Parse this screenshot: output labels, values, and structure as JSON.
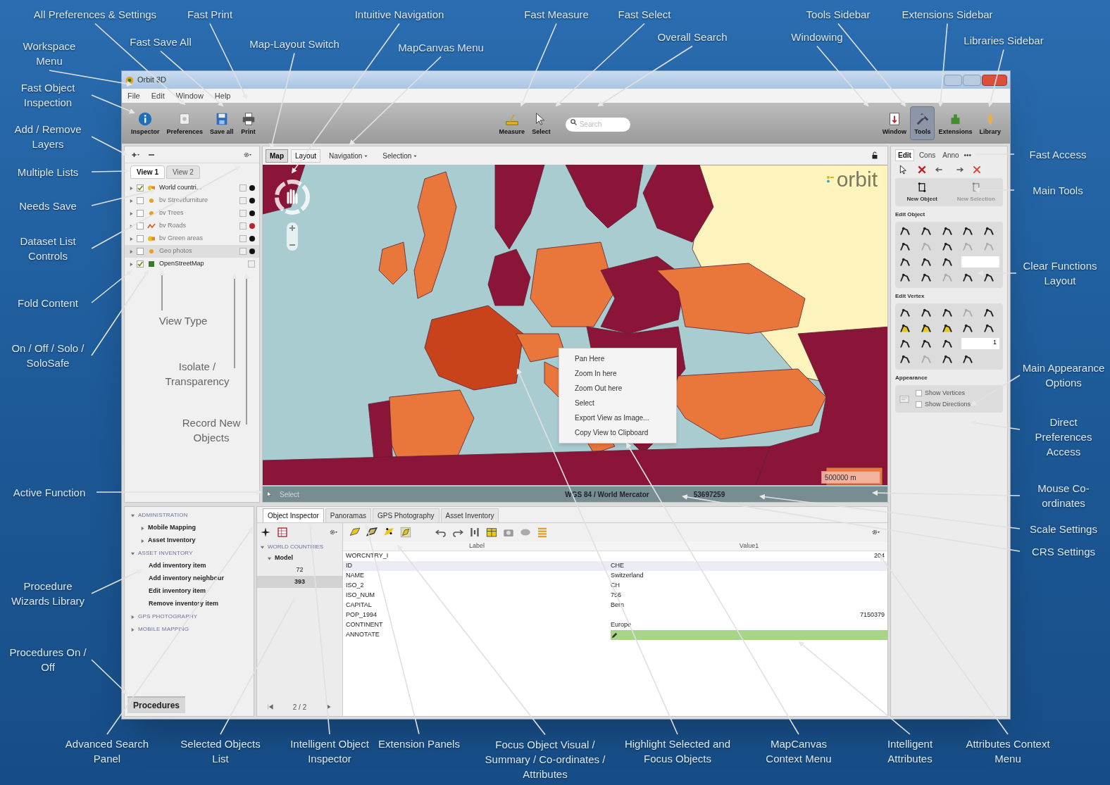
{
  "callouts": [
    {
      "text": "All Preferences & Settings"
    },
    {
      "text": "Fast Print"
    },
    {
      "text": "Fast Save All"
    },
    {
      "text": "Workspace Menu"
    },
    {
      "text": "Map-Layout Switch"
    },
    {
      "text": "Intuitive Navigation"
    },
    {
      "text": "MapCanvas Menu"
    },
    {
      "text": "Fast Measure"
    },
    {
      "text": "Fast Select"
    },
    {
      "text": "Overall Search"
    },
    {
      "text": "Tools Sidebar"
    },
    {
      "text": "Windowing"
    },
    {
      "text": "Extensions Sidebar"
    },
    {
      "text": "Libraries Sidebar"
    },
    {
      "text": "Fast Object Inspection"
    },
    {
      "text": "Add / Remove Layers"
    },
    {
      "text": "Multiple Lists"
    },
    {
      "text": "Needs Save"
    },
    {
      "text": "Dataset List Controls"
    },
    {
      "text": "Fold Content"
    },
    {
      "text": "On / Off / Solo / SoloSafe"
    },
    {
      "text": "View Type"
    },
    {
      "text": "Isolate / Transparency"
    },
    {
      "text": "Record New Objects"
    },
    {
      "text": "Active Function"
    },
    {
      "text": "Procedure Wizards Library"
    },
    {
      "text": "Procedures On / Off"
    },
    {
      "text": "Fast Access"
    },
    {
      "text": "Main Tools"
    },
    {
      "text": "Clear Functions Layout"
    },
    {
      "text": "Main Appearance Options"
    },
    {
      "text": "Direct Preferences Access"
    },
    {
      "text": "Mouse Co-ordinates"
    },
    {
      "text": "Scale Settings"
    },
    {
      "text": "CRS Settings"
    },
    {
      "text": "Advanced Search Panel"
    },
    {
      "text": "Selected Objects List"
    },
    {
      "text": "Intelligent Object Inspector"
    },
    {
      "text": "Extension Panels"
    },
    {
      "text": "Focus Object Visual / Summary / Co-ordinates / Attributes"
    },
    {
      "text": "Highlight Selected and Focus Objects"
    },
    {
      "text": "MapCanvas Context Menu"
    },
    {
      "text": "Intelligent Attributes"
    },
    {
      "text": "Attributes Context Menu"
    }
  ],
  "window": {
    "title": "Orbit 3D"
  },
  "menu": [
    "File",
    "Edit",
    "Window",
    "Help"
  ],
  "toolbar": {
    "left": [
      {
        "label": "Inspector",
        "kind": "info"
      },
      {
        "label": "Preferences",
        "kind": "prefs"
      },
      {
        "label": "Save all",
        "kind": "save"
      },
      {
        "label": "Print",
        "kind": "print"
      }
    ],
    "center": [
      {
        "label": "Measure",
        "kind": "measure"
      },
      {
        "label": "Select",
        "kind": "select"
      }
    ],
    "search": {
      "placeholder": "Search"
    },
    "right": [
      {
        "label": "Window",
        "kind": "window",
        "selected": false
      },
      {
        "label": "Tools",
        "kind": "tools",
        "selected": true
      },
      {
        "label": "Extensions",
        "kind": "extensions",
        "selected": false
      },
      {
        "label": "Library",
        "kind": "library",
        "selected": false
      }
    ]
  },
  "layers_panel": {
    "tabs": [
      {
        "label": "View 1",
        "selected": true
      },
      {
        "label": "View 2",
        "selected": false
      }
    ],
    "layers": [
      {
        "name": "World countri...",
        "visible": true,
        "isolated": false,
        "selected": false,
        "kind": "polygon",
        "color": "#111111"
      },
      {
        "name": "bv Streetfurniture",
        "visible": false,
        "isolated": false,
        "selected": false,
        "kind": "point",
        "color": "#111111"
      },
      {
        "name": "bv Trees",
        "visible": false,
        "isolated": false,
        "selected": false,
        "kind": "point",
        "color": "#111111"
      },
      {
        "name": "bv Roads",
        "visible": false,
        "isolated": false,
        "selected": false,
        "kind": "line",
        "color": "#c0202a"
      },
      {
        "name": "bv Green areas",
        "visible": false,
        "isolated": false,
        "selected": false,
        "kind": "polygon",
        "color": "#111111"
      },
      {
        "name": "Geo photos",
        "visible": false,
        "isolated": false,
        "selected": true,
        "kind": "point",
        "color": "#111111"
      },
      {
        "name": "OpenStreetMap",
        "visible": true,
        "isolated": false,
        "selected": false,
        "kind": "raster"
      }
    ]
  },
  "map": {
    "tabs": [
      {
        "label": "Map",
        "selected": true
      },
      {
        "label": "Layout",
        "selected": false
      }
    ],
    "menus": [
      "Navigation",
      "Selection"
    ],
    "logo": "orbit",
    "context_menu": [
      "Pan Here",
      "Zoom In here",
      "Zoom Out here",
      "Select",
      "Export View as Image...",
      "Copy View to Clipboard"
    ],
    "scale_field": "500000 m",
    "status": {
      "active_function": "Select",
      "crs": "WGS 84 / World Mercator",
      "scale": "53697259"
    }
  },
  "sidebar": {
    "tabs": [
      {
        "label": "Edit",
        "selected": true
      },
      {
        "label": "Cons",
        "selected": false
      },
      {
        "label": "Anno",
        "selected": false
      }
    ],
    "more": "•••",
    "main_tools": [
      {
        "label": "New Object",
        "disabled": false
      },
      {
        "label": "New Selection",
        "disabled": true
      }
    ],
    "sections": [
      {
        "title": "Edit Object",
        "tools": [
          {
            "kind": "tool",
            "disabled": false
          },
          {
            "kind": "tool",
            "disabled": false
          },
          {
            "kind": "tool",
            "disabled": false
          },
          {
            "kind": "tool",
            "disabled": false
          },
          {
            "kind": "tool",
            "disabled": false
          },
          {
            "kind": "tool",
            "disabled": false
          },
          {
            "kind": "tool",
            "disabled": true
          },
          {
            "kind": "tool",
            "disabled": false
          },
          {
            "kind": "tool",
            "disabled": true
          },
          {
            "kind": "tool",
            "disabled": true
          },
          {
            "kind": "tool",
            "disabled": false
          },
          {
            "kind": "tool",
            "disabled": false
          },
          {
            "kind": "tool",
            "disabled": false
          },
          {
            "kind": "field"
          },
          {
            "kind": "tool",
            "disabled": false
          },
          {
            "kind": "tool",
            "disabled": false
          },
          {
            "kind": "tool",
            "disabled": true
          },
          {
            "kind": "tool",
            "disabled": false
          },
          {
            "kind": "tool",
            "disabled": false
          }
        ]
      },
      {
        "title": "Edit Vertex",
        "tools": [
          {
            "kind": "tool",
            "disabled": false
          },
          {
            "kind": "tool",
            "disabled": false
          },
          {
            "kind": "tool",
            "disabled": false
          },
          {
            "kind": "tool",
            "disabled": true
          },
          {
            "kind": "tool",
            "disabled": false
          },
          {
            "kind": "tool",
            "disabled": false
          },
          {
            "kind": "tool",
            "disabled": false
          },
          {
            "kind": "tool",
            "disabled": false
          },
          {
            "kind": "tool",
            "disabled": false
          },
          {
            "kind": "tool",
            "disabled": false
          },
          {
            "kind": "tool",
            "disabled": false
          },
          {
            "kind": "tool",
            "disabled": false
          },
          {
            "kind": "tool",
            "disabled": false
          },
          {
            "kind": "field",
            "value": "1"
          },
          {
            "kind": "tool",
            "disabled": false
          },
          {
            "kind": "tool",
            "disabled": true
          },
          {
            "kind": "tool",
            "disabled": false
          },
          {
            "kind": "tool",
            "disabled": false
          }
        ]
      }
    ],
    "appearance": {
      "title": "Appearance",
      "options": [
        {
          "label": "Show Vertices",
          "checked": false
        },
        {
          "label": "Show Directions",
          "checked": false
        }
      ]
    }
  },
  "procedures": {
    "tree": [
      {
        "label": "ADMINISTRATION",
        "expanded": true,
        "children": [
          {
            "label": "Mobile Mapping",
            "expanded": false
          },
          {
            "label": "Asset Inventory",
            "expanded": false
          }
        ]
      },
      {
        "label": "ASSET INVENTORY",
        "expanded": true,
        "children": [
          {
            "label": "Add inventory item"
          },
          {
            "label": "Add inventory neighbour"
          },
          {
            "label": "Edit inventory item"
          },
          {
            "label": "Remove inventory item"
          }
        ]
      },
      {
        "label": "GPS PHOTOGRAPHY",
        "expanded": false
      },
      {
        "label": "MOBILE MAPPING",
        "expanded": false
      }
    ],
    "button": "Procedures"
  },
  "inspector": {
    "tabs": [
      {
        "label": "Object Inspector",
        "selected": true
      },
      {
        "label": "Panoramas",
        "selected": false
      },
      {
        "label": "GPS Photography",
        "selected": false
      },
      {
        "label": "Asset Inventory",
        "selected": false
      }
    ],
    "selection": {
      "dataset": "WORLD COUNTRIES",
      "group": "Model",
      "items": [
        {
          "label": "72",
          "selected": false
        },
        {
          "label": "393",
          "selected": true
        }
      ]
    },
    "pager": "2 / 2",
    "columns": [
      "Label",
      "Value1"
    ],
    "rows": [
      {
        "label": "WORCNTRY_I",
        "value": "204",
        "kind": "number",
        "highlighted": false
      },
      {
        "label": "ID",
        "value": "CHE",
        "kind": "text",
        "highlighted": false
      },
      {
        "label": "NAME",
        "value": "Switzerland",
        "kind": "text",
        "highlighted": false
      },
      {
        "label": "ISO_2",
        "value": "CH",
        "kind": "text",
        "highlighted": false
      },
      {
        "label": "ISO_NUM",
        "value": "756",
        "kind": "text",
        "highlighted": false
      },
      {
        "label": "CAPITAL",
        "value": "Bern",
        "kind": "text",
        "highlighted": false
      },
      {
        "label": "POP_1994",
        "value": "7150379",
        "kind": "number",
        "highlighted": false
      },
      {
        "label": "CONTINENT",
        "value": "Europe",
        "kind": "text",
        "highlighted": false
      },
      {
        "label": "ANNOTATE",
        "kind": "annotation",
        "highlighted": true
      }
    ]
  }
}
